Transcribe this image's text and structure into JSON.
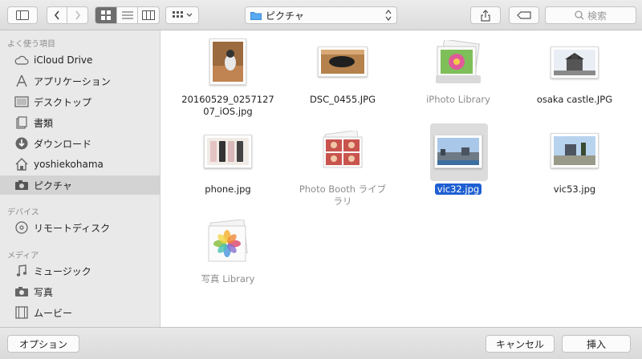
{
  "toolbar": {
    "path_label": "ピクチャ",
    "search_placeholder": "検索"
  },
  "sidebar": {
    "sections": [
      {
        "label": "よく使う項目"
      },
      {
        "label": "デバイス"
      },
      {
        "label": "メディア"
      }
    ],
    "favorites": [
      {
        "label": "iCloud Drive",
        "icon": "cloud-icon"
      },
      {
        "label": "アプリケーション",
        "icon": "applications-icon"
      },
      {
        "label": "デスクトップ",
        "icon": "desktop-icon"
      },
      {
        "label": "書類",
        "icon": "documents-icon"
      },
      {
        "label": "ダウンロード",
        "icon": "download-icon"
      },
      {
        "label": "yoshiekohama",
        "icon": "home-icon"
      },
      {
        "label": "ピクチャ",
        "icon": "camera-icon",
        "selected": true
      }
    ],
    "devices": [
      {
        "label": "リモートディスク",
        "icon": "disc-icon"
      }
    ],
    "media": [
      {
        "label": "ミュージック",
        "icon": "music-icon"
      },
      {
        "label": "写真",
        "icon": "camera-icon"
      },
      {
        "label": "ムービー",
        "icon": "film-icon"
      }
    ]
  },
  "files": [
    {
      "name": "20160529_025712707_iOS.jpg",
      "line1": "20160529_0257127",
      "line2": "07_iOS.jpg"
    },
    {
      "name": "DSC_0455.JPG",
      "line1": "DSC_0455.JPG"
    },
    {
      "name": "iPhoto Library",
      "line1": "iPhoto Library",
      "dimmed": true
    },
    {
      "name": "osaka castle.JPG",
      "line1": "osaka castle.JPG"
    },
    {
      "name": "phone.jpg",
      "line1": "phone.jpg"
    },
    {
      "name": "Photo Booth ライブラリ",
      "line1": "Photo Booth ライブ",
      "line2": "ラリ",
      "dimmed": true
    },
    {
      "name": "vic32.jpg",
      "line1": "vic32.jpg",
      "selected": true
    },
    {
      "name": "vic53.jpg",
      "line1": "vic53.jpg"
    },
    {
      "name": "写真 Library",
      "line1": "写真 Library",
      "dimmed": true
    }
  ],
  "bottom": {
    "options_label": "オプション",
    "cancel_label": "キャンセル",
    "insert_label": "挿入"
  },
  "colors": {
    "selection_blue": "#1e5fd1",
    "sidebar_bg": "#e9e9e9"
  }
}
